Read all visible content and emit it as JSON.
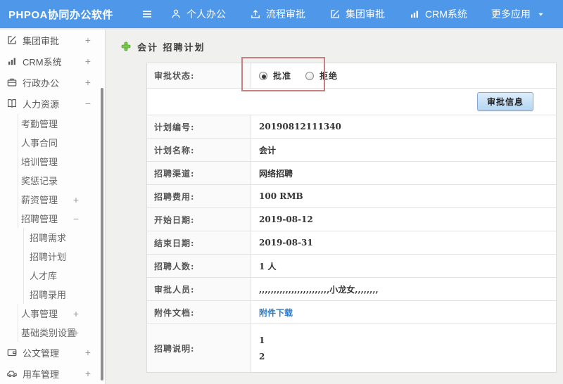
{
  "colors": {
    "topbar_blue": "#4f97e8",
    "link_blue": "#2a7ccc",
    "annotation_red": "#c97f7f",
    "button_border_blue": "#84abd3"
  },
  "topbar": {
    "title": "PHPOA协同办公软件",
    "nav": [
      {
        "name": "personal-office",
        "icon": "user-icon",
        "label": "个人办公",
        "caret": false
      },
      {
        "name": "process-approval",
        "icon": "upload-icon",
        "label": "流程审批",
        "caret": false
      },
      {
        "name": "group-approval",
        "icon": "edit-icon",
        "label": "集团审批",
        "caret": false
      },
      {
        "name": "crm-system",
        "icon": "chart-icon",
        "label": "CRM系统",
        "caret": false
      },
      {
        "name": "more-apps",
        "icon": "",
        "label": "更多应用",
        "caret": true
      }
    ]
  },
  "sidebar": {
    "items": [
      {
        "name": "group-approval",
        "label": "集团审批",
        "level": 1,
        "icon": "edit-icon",
        "expand": "+"
      },
      {
        "name": "crm-system",
        "label": "CRM系统",
        "level": 1,
        "icon": "chart-icon",
        "expand": "+"
      },
      {
        "name": "admin-office",
        "label": "行政办公",
        "level": 1,
        "icon": "briefcase-icon",
        "expand": "+"
      },
      {
        "name": "human-resources",
        "label": "人力资源",
        "level": 1,
        "icon": "book-icon",
        "expand": "−"
      },
      {
        "name": "attendance-management",
        "label": "考勤管理",
        "level": 2,
        "expand": ""
      },
      {
        "name": "personnel-contract",
        "label": "人事合同",
        "level": 2,
        "expand": ""
      },
      {
        "name": "training-management",
        "label": "培训管理",
        "level": 2,
        "expand": ""
      },
      {
        "name": "reward-punishment-records",
        "label": "奖惩记录",
        "level": 2,
        "expand": ""
      },
      {
        "name": "salary-management",
        "label": "薪资管理",
        "level": 2,
        "expand": "+"
      },
      {
        "name": "recruitment-management",
        "label": "招聘管理",
        "level": 2,
        "expand": "−"
      },
      {
        "name": "recruitment-needs",
        "label": "招聘需求",
        "level": 3,
        "expand": ""
      },
      {
        "name": "recruitment-plan",
        "label": "招聘计划",
        "level": 3,
        "expand": ""
      },
      {
        "name": "talent-pool",
        "label": "人才库",
        "level": 3,
        "expand": ""
      },
      {
        "name": "recruitment-hiring",
        "label": "招聘录用",
        "level": 3,
        "expand": ""
      },
      {
        "name": "personnel-management",
        "label": "人事管理",
        "level": 2,
        "expand": "+"
      },
      {
        "name": "basic-category-settings",
        "label": "基础类别设置",
        "level": 2,
        "expand": "+"
      },
      {
        "name": "document-management",
        "label": "公文管理",
        "level": 1,
        "icon": "wallet-icon",
        "expand": "+"
      },
      {
        "name": "vehicle-management",
        "label": "用车管理",
        "level": 1,
        "icon": "car-icon",
        "expand": "+"
      }
    ]
  },
  "breadcrumb": {
    "text": "会计 招聘计划"
  },
  "detail": {
    "status_row": {
      "label": "审批状态:",
      "options": [
        {
          "label": "批准",
          "checked": true
        },
        {
          "label": "拒绝",
          "checked": false
        }
      ]
    },
    "approve_button": "审批信息",
    "rows": [
      {
        "name": "plan-number",
        "label": "计划编号:",
        "value": "20190812111340"
      },
      {
        "name": "plan-name",
        "label": "计划名称:",
        "value": "会计"
      },
      {
        "name": "recruitment-channel",
        "label": "招聘渠道:",
        "value": "网络招聘"
      },
      {
        "name": "recruitment-cost",
        "label": "招聘费用:",
        "value": "100 RMB"
      },
      {
        "name": "start-date",
        "label": "开始日期:",
        "value": "2019-08-12"
      },
      {
        "name": "end-date",
        "label": "结束日期:",
        "value": "2019-08-31"
      },
      {
        "name": "recruitment-headcount",
        "label": "招聘人数:",
        "value": "1 人"
      },
      {
        "name": "approvers",
        "label": "审批人员:",
        "value": ",,,,,,,,,,,,,,,,,,,,,,,,小龙女,,,,,,,,"
      },
      {
        "name": "attachment-document",
        "label": "附件文档:",
        "value": "附件下载",
        "link": true
      },
      {
        "name": "recruitment-description",
        "label": "招聘说明:",
        "value_lines": [
          "1",
          "2"
        ]
      }
    ]
  }
}
